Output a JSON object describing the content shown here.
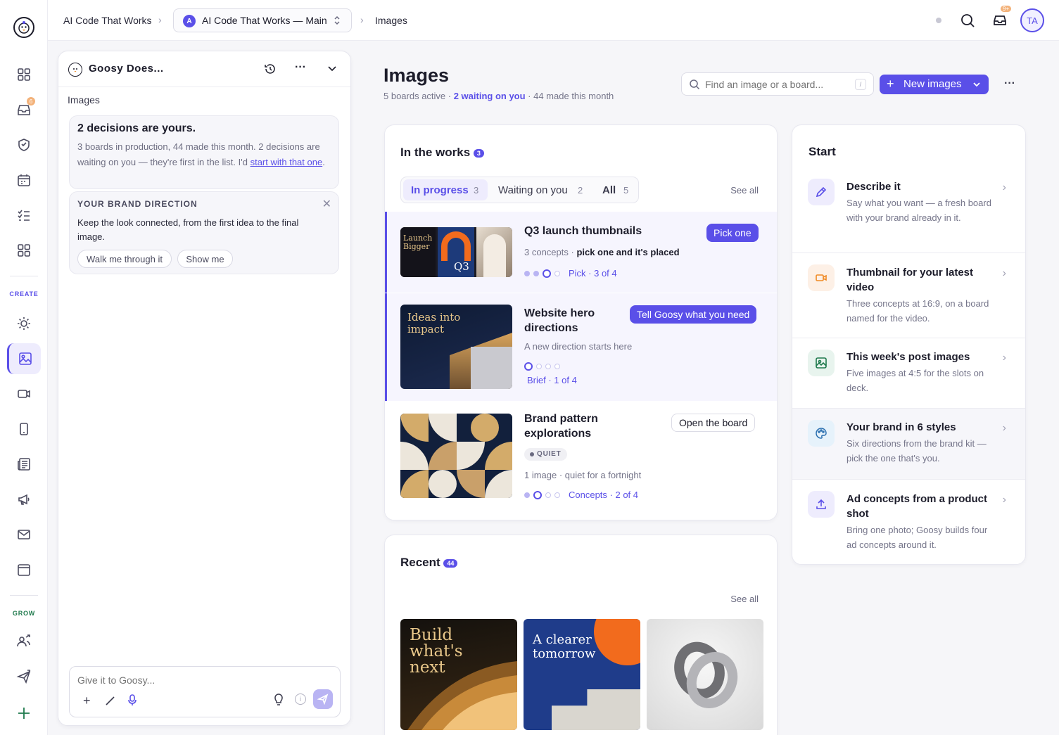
{
  "colors": {
    "accent": "#5a4fe8",
    "rail_bg": "#ffffff",
    "page_bg": "#f6f6f9",
    "create": "#5a4fe8",
    "grow": "#1f7a4d"
  },
  "rail": {
    "logo_icon": "goose-logo-icon",
    "notification_count": "6",
    "create_label": "CREATE",
    "grow_label": "GROW"
  },
  "topbar": {
    "breadcrumb_root": "AI Code That Works",
    "workspace_avatar": "A",
    "workspace_name": "AI Code That Works — Main",
    "page_crumb": "Images",
    "inbox_badge": "9+",
    "user_initials": "TA"
  },
  "chat": {
    "title": "Goosy Does...",
    "context_label": "Images",
    "decision_title": "2 decisions are yours.",
    "decision_text": "3 boards in production, 44 made this month. 2 decisions are waiting on you — they're first in the list. I'd ",
    "decision_link": "start with that one",
    "decision_end": ".",
    "brand_heading": "YOUR BRAND DIRECTION",
    "brand_text": "Keep the look connected, from the first idea to the final image.",
    "walk_label": "Walk me through it",
    "show_label": "Show me",
    "input_placeholder": "Give it to Goosy..."
  },
  "header": {
    "title": "Images",
    "subtitle_a": "5 boards active · ",
    "subtitle_waiting": "2 waiting on you",
    "subtitle_b": " · 44 made this month",
    "search_placeholder": "Find an image or a board...",
    "search_shortcut": "/",
    "new_button": "New images"
  },
  "works": {
    "title": "In the works",
    "count": "3",
    "tabs": [
      {
        "label": "In progress",
        "count": "3"
      },
      {
        "label": "Waiting on you",
        "count": "2"
      },
      {
        "label": "All",
        "count": "5"
      }
    ],
    "see_all": "See all",
    "items": [
      {
        "title": "Q3 launch thumbnails",
        "meta_a": "3 concepts · ",
        "meta_b": "pick one and it's placed",
        "action": "Pick one",
        "step": "Pick · 3 of 4",
        "thumb_text_a": "Launch Bigger",
        "thumb_text_b": "Q3"
      },
      {
        "title": "Website hero directions",
        "meta_a": "A new direction starts here",
        "action": "Tell Goosy what you need",
        "step": "Brief · 1 of 4",
        "thumb_text_a": "Ideas into impact"
      },
      {
        "title": "Brand pattern explorations",
        "tag": "QUIET",
        "meta_a": "1 image · quiet for a fortnight",
        "action": "Open the board",
        "step": "Concepts · 2 of 4"
      }
    ]
  },
  "recent": {
    "title": "Recent",
    "count": "44",
    "see_all": "See all",
    "thumb_a": "Build what's next",
    "thumb_b": "A clearer tomorrow"
  },
  "start": {
    "title": "Start",
    "items": [
      {
        "title": "Describe it",
        "desc": "Say what you want — a fresh board with your brand already in it.",
        "icon": "pencil-icon"
      },
      {
        "title": "Thumbnail for your latest video",
        "desc": "Three concepts at 16:9, on a board named for the video.",
        "icon": "video-icon"
      },
      {
        "title": "This week's post images",
        "desc": "Five images at 4:5 for the slots on deck.",
        "icon": "image-icon"
      },
      {
        "title": "Your brand in 6 styles",
        "desc": "Six directions from the brand kit — pick the one that's you.",
        "icon": "palette-icon"
      },
      {
        "title": "Ad concepts from a product shot",
        "desc": "Bring one photo; Goosy builds four ad concepts around it.",
        "icon": "upload-icon"
      }
    ]
  }
}
